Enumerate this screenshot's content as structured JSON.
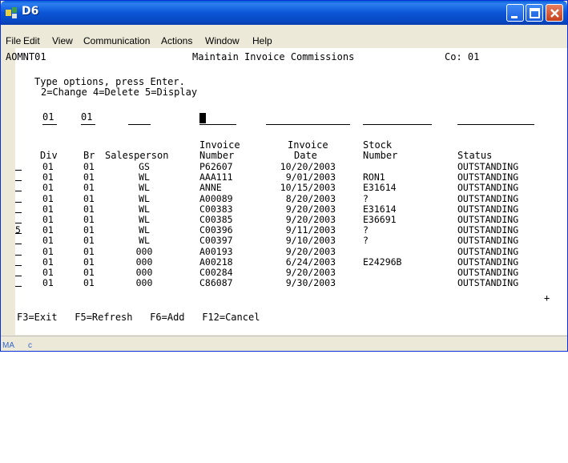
{
  "window": {
    "title": "D6"
  },
  "menu": [
    {
      "label": "File"
    },
    {
      "label": "Edit"
    },
    {
      "label": "View"
    },
    {
      "label": "Communication"
    },
    {
      "label": "Actions"
    },
    {
      "label": "Window"
    },
    {
      "label": "Help"
    }
  ],
  "screen": {
    "program_id": "AOMNT01",
    "title": "Maintain Invoice Commissions",
    "company": "Co: 01",
    "instructions": "Type options, press Enter.",
    "options": "2=Change 4=Delete 5=Display",
    "filters": {
      "div": "01",
      "br": "01"
    },
    "headers": {
      "div": "Div",
      "br": "Br",
      "salesperson": "Salesperson",
      "invoice_number_1": "Invoice",
      "invoice_number_2": "Number",
      "invoice_date_1": "Invoice",
      "invoice_date_2": "Date",
      "stock_1": "Stock",
      "stock_2": "Number",
      "status": "Status"
    },
    "rows": [
      {
        "opt": "",
        "div": "01",
        "br": "01",
        "sp": "GS",
        "inv": "P62607",
        "date": "10/20/2003",
        "stock": "",
        "status": "OUTSTANDING"
      },
      {
        "opt": "",
        "div": "01",
        "br": "01",
        "sp": "WL",
        "inv": "AAA111",
        "date": "9/01/2003",
        "stock": "RON1",
        "status": "OUTSTANDING"
      },
      {
        "opt": "",
        "div": "01",
        "br": "01",
        "sp": "WL",
        "inv": "ANNE",
        "date": "10/15/2003",
        "stock": "E31614",
        "status": "OUTSTANDING"
      },
      {
        "opt": "",
        "div": "01",
        "br": "01",
        "sp": "WL",
        "inv": "A00089",
        "date": "8/20/2003",
        "stock": "?",
        "status": "OUTSTANDING"
      },
      {
        "opt": "",
        "div": "01",
        "br": "01",
        "sp": "WL",
        "inv": "C00383",
        "date": "9/20/2003",
        "stock": "E31614",
        "status": "OUTSTANDING"
      },
      {
        "opt": "",
        "div": "01",
        "br": "01",
        "sp": "WL",
        "inv": "C00385",
        "date": "9/20/2003",
        "stock": "E36691",
        "status": "OUTSTANDING"
      },
      {
        "opt": "5",
        "div": "01",
        "br": "01",
        "sp": "WL",
        "inv": "C00396",
        "date": "9/11/2003",
        "stock": "?",
        "status": "OUTSTANDING"
      },
      {
        "opt": "",
        "div": "01",
        "br": "01",
        "sp": "WL",
        "inv": "C00397",
        "date": "9/10/2003",
        "stock": "?",
        "status": "OUTSTANDING"
      },
      {
        "opt": "",
        "div": "01",
        "br": "01",
        "sp": "000",
        "inv": "A00193",
        "date": "9/20/2003",
        "stock": "",
        "status": "OUTSTANDING"
      },
      {
        "opt": "",
        "div": "01",
        "br": "01",
        "sp": "000",
        "inv": "A00218",
        "date": "6/24/2003",
        "stock": "E24296B",
        "status": "OUTSTANDING"
      },
      {
        "opt": "",
        "div": "01",
        "br": "01",
        "sp": "000",
        "inv": "C00284",
        "date": "9/20/2003",
        "stock": "",
        "status": "OUTSTANDING"
      },
      {
        "opt": "",
        "div": "01",
        "br": "01",
        "sp": "000",
        "inv": "C86087",
        "date": "9/30/2003",
        "stock": "",
        "status": "OUTSTANDING"
      }
    ],
    "more_indicator": "+",
    "function_keys": "F3=Exit   F5=Refresh   F6=Add   F12=Cancel"
  },
  "statusbar": {
    "mode": "MA",
    "field": "c"
  }
}
